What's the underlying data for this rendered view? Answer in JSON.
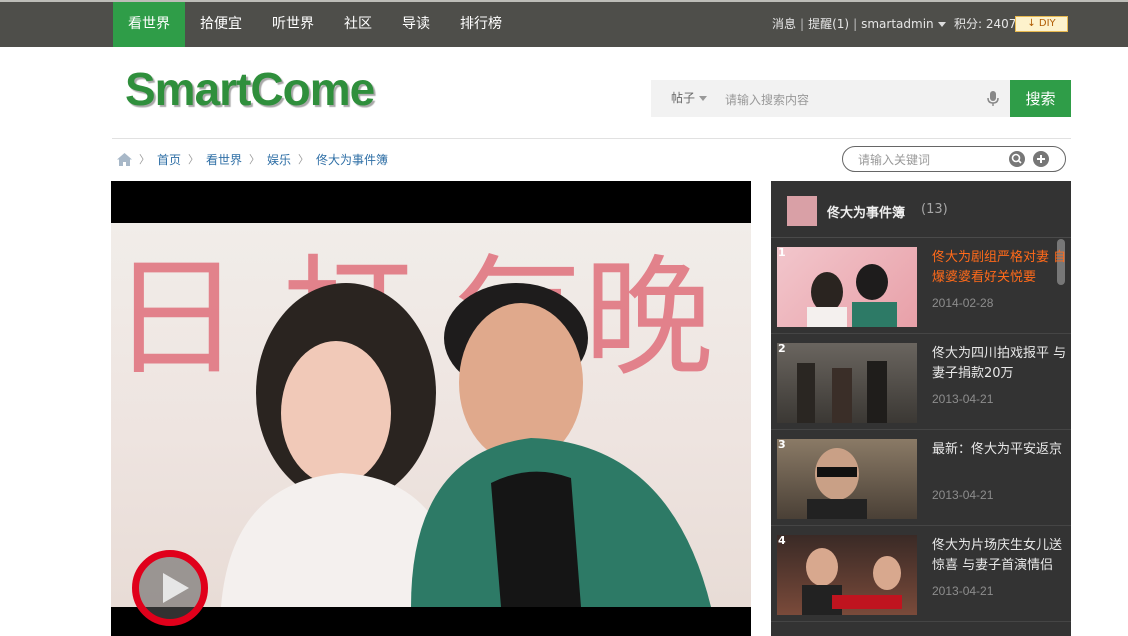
{
  "nav": {
    "items": [
      "看世界",
      "拾便宜",
      "听世界",
      "社区",
      "导读",
      "排行榜"
    ],
    "active_index": 0
  },
  "userbar": {
    "messages": "消息",
    "reminder": "提醒(1)",
    "username": "smartadmin",
    "points": "积分: 2407",
    "diy": "DIY"
  },
  "header": {
    "logo": "SmartCome",
    "search_type": "帖子",
    "search_placeholder": "请输入搜索内容",
    "search_button": "搜索"
  },
  "breadcrumb": {
    "items": [
      "首页",
      "看世界",
      "娱乐",
      "佟大为事件簿"
    ]
  },
  "keyword_search": {
    "placeholder": "请输入关键词"
  },
  "video": {
    "poster_text": "日 打 每晚"
  },
  "sidebar": {
    "title": "佟大为事件簿",
    "count": "(13)",
    "items": [
      {
        "num": "1",
        "title": "佟大为剧组严格对妻 自爆婆婆看好关悦要",
        "date": "2014-02-28"
      },
      {
        "num": "2",
        "title": "佟大为四川拍戏报平 与妻子捐款20万",
        "date": "2013-04-21"
      },
      {
        "num": "3",
        "title": "最新：佟大为平安返京",
        "date": "2013-04-21"
      },
      {
        "num": "4",
        "title": "佟大为片场庆生女儿送 惊喜 与妻子首演情侣",
        "date": "2013-04-21"
      }
    ]
  },
  "colors": {
    "nav_bg": "#4e4e4a",
    "accent_green": "#2f9d48",
    "sidebar_bg": "#333333",
    "active_title": "#ff6a1a",
    "play_ring": "#e0001b"
  }
}
